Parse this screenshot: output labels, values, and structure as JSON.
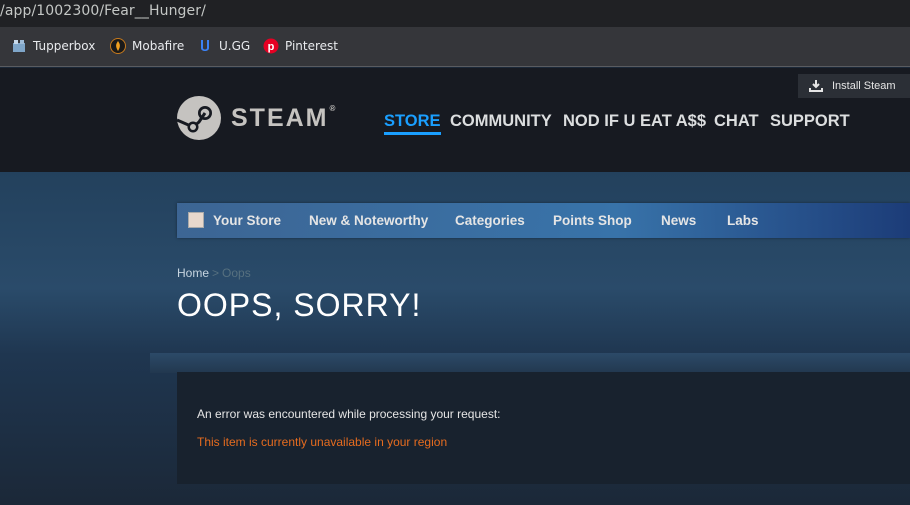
{
  "browser": {
    "url": "/app/1002300/Fear__Hunger/",
    "bookmarks": [
      {
        "label": "Tupperbox",
        "icon": "tupperbox-icon"
      },
      {
        "label": "Mobafire",
        "icon": "mobafire-icon"
      },
      {
        "label": "U.GG",
        "icon": "ugg-icon"
      },
      {
        "label": "Pinterest",
        "icon": "pinterest-icon"
      }
    ]
  },
  "header": {
    "install_label": "Install Steam",
    "logo_text": "STEAM",
    "logo_reg": "®",
    "nav": [
      "STORE",
      "COMMUNITY",
      "NOD IF U EAT A$$",
      "CHAT",
      "SUPPORT"
    ]
  },
  "store_nav": {
    "tabs": [
      "Your Store",
      "New & Noteworthy",
      "Categories",
      "Points Shop",
      "News",
      "Labs"
    ]
  },
  "breadcrumb": {
    "home": "Home",
    "separator": ">",
    "current": "Oops"
  },
  "page": {
    "title": "OOPS, SORRY!"
  },
  "error": {
    "message": "An error was encountered while processing your request:",
    "detail": "This item is currently unavailable in your region"
  },
  "colors": {
    "accent": "#1a9fff",
    "error": "#e66c1f",
    "header_bg": "#171a21",
    "page_bg": "#1b2838"
  }
}
